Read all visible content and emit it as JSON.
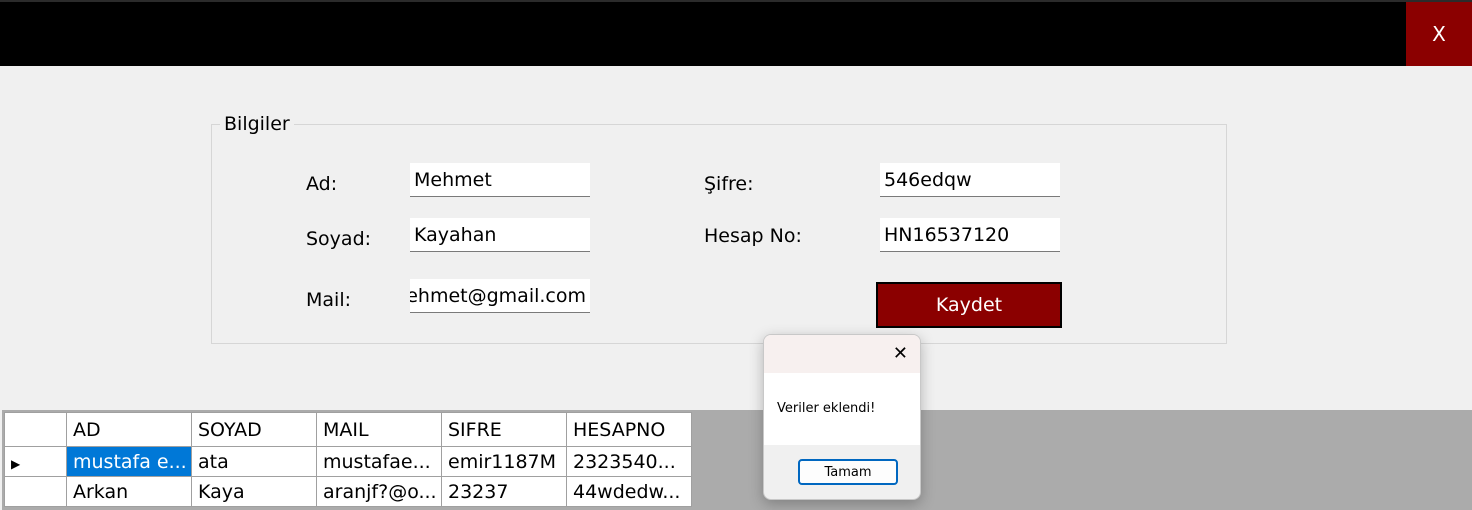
{
  "window": {
    "close_label": "X"
  },
  "group": {
    "title": "Bilgiler"
  },
  "form": {
    "ad_label": "Ad:",
    "ad_value": "Mehmet",
    "soyad_label": "Soyad:",
    "soyad_value": "Kayahan",
    "mail_label": "Mail:",
    "mail_value": "mehmet@gmail.com",
    "sifre_label": "Şifre:",
    "sifre_value": "546edqw",
    "hesapno_label": "Hesap No:",
    "hesapno_value": "HN16537120",
    "save_label": "Kaydet"
  },
  "grid": {
    "columns": [
      "AD",
      "SOYAD",
      "MAIL",
      "SIFRE",
      "HESAPNO"
    ],
    "rows": [
      [
        "mustafa e...",
        "ata",
        "mustafae...",
        "emir1187M",
        "2323540..."
      ],
      [
        "Arkan",
        "Kaya",
        "aranjf?@o...",
        "23237",
        "44wdedw..."
      ]
    ],
    "current_row_marker": "▶"
  },
  "dialog": {
    "close_label": "✕",
    "message": "Veriler eklendi!",
    "ok_label": "Tamam"
  },
  "colors": {
    "accent": "#8b0000",
    "titlebar": "#000000",
    "selection": "#0078d7"
  }
}
